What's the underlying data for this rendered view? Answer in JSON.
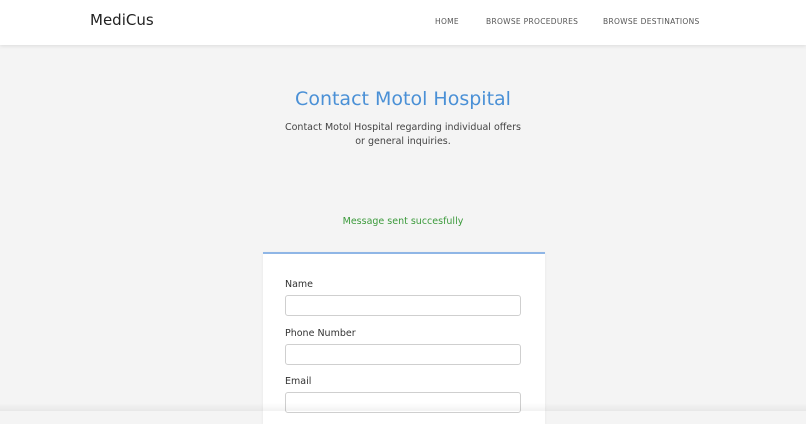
{
  "navbar": {
    "brand": "MediCus",
    "links": [
      {
        "label": "HOME"
      },
      {
        "label": "BROWSE PROCEDURES"
      },
      {
        "label": "BROWSE DESTINATIONS"
      }
    ]
  },
  "header": {
    "title": "Contact Motol Hospital",
    "subtitle": "Contact Motol Hospital regarding individual offers or general inquiries."
  },
  "status": {
    "message": "Message sent succesfully",
    "color": "#3b9a3b"
  },
  "form": {
    "fields": [
      {
        "label": "Name",
        "value": "",
        "placeholder": ""
      },
      {
        "label": "Phone Number",
        "value": "",
        "placeholder": ""
      },
      {
        "label": "Email",
        "value": "",
        "placeholder": ""
      }
    ]
  },
  "colors": {
    "accent": "#4a90d6",
    "background": "#f4f4f4"
  }
}
